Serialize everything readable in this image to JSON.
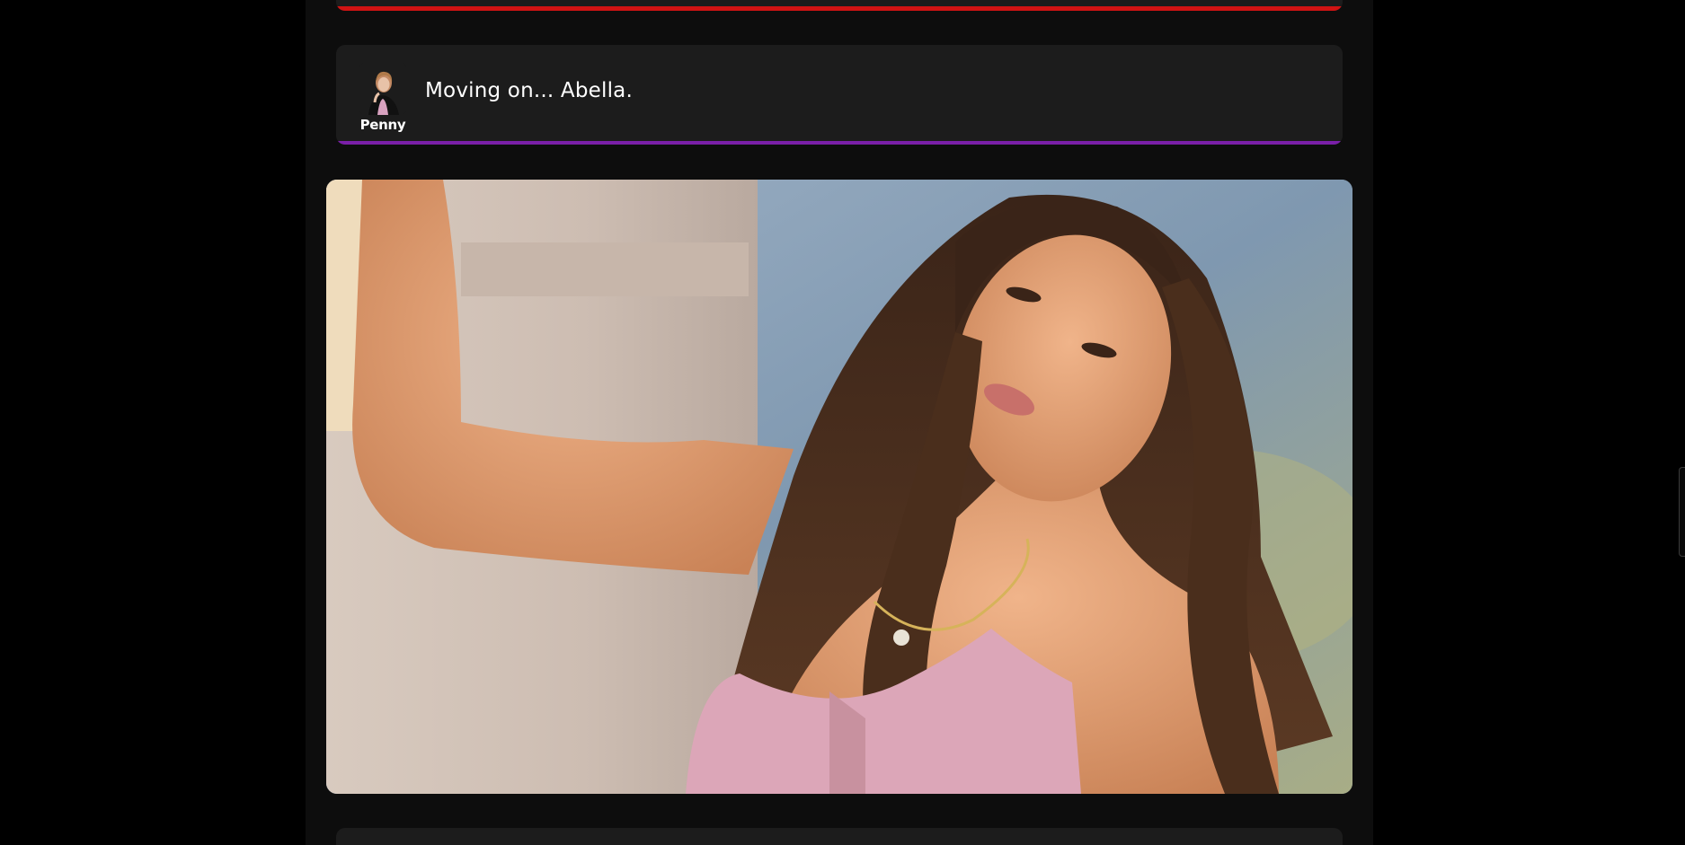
{
  "feed": {
    "message": {
      "speaker": "Penny",
      "text": "Moving on... Abella.",
      "accent_color": "#7a1fa8",
      "avatar_icon": "avatar-portrait-icon"
    },
    "previous_card": {
      "accent_color": "#d11313"
    },
    "photo": {
      "subject": "portrait-photo"
    },
    "next_card": {
      "text": ""
    }
  },
  "colors": {
    "background": "#000000",
    "column": "#0d0d0d",
    "card": "#1c1c1c"
  }
}
